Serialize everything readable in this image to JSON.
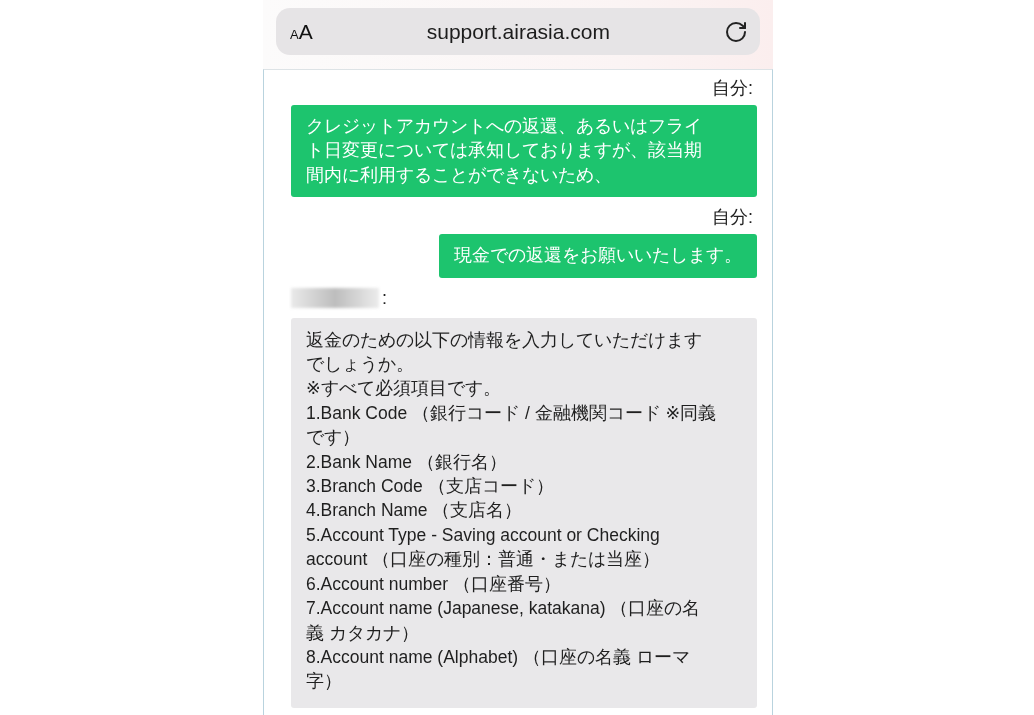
{
  "address_bar": {
    "text_size_small": "A",
    "text_size_large": "A",
    "url": "support.airasia.com"
  },
  "messages": [
    {
      "kind": "outgoing",
      "sender": "自分:",
      "lines": [
        "クレジットアカウントへの返還、あるいはフライ",
        "ト日変更については承知しておりますが、該当期",
        "間内に利用することができないため、"
      ]
    },
    {
      "kind": "outgoing",
      "sender": "自分:",
      "lines": [
        "現金での返還をお願いいたします。"
      ]
    },
    {
      "kind": "incoming",
      "sender": ":",
      "sender_redacted": true,
      "lines": [
        "返金のための以下の情報を入力していただけます",
        "でしょうか。",
        "※すべて必須項目です。",
        "1.Bank Code （銀行コード / 金融機関コード ※同義",
        "です）",
        "2.Bank Name （銀行名）",
        "3.Branch Code （支店コード）",
        "4.Branch Name （支店名）",
        "5.Account Type - Saving account or Checking",
        "account （口座の種別：普通・または当座）",
        "6.Account number （口座番号）",
        "7.Account name (Japanese, katakana) （口座の名",
        "義 カタカナ）",
        "8.Account name (Alphabet) （口座の名義 ローマ",
        "字）"
      ]
    }
  ]
}
